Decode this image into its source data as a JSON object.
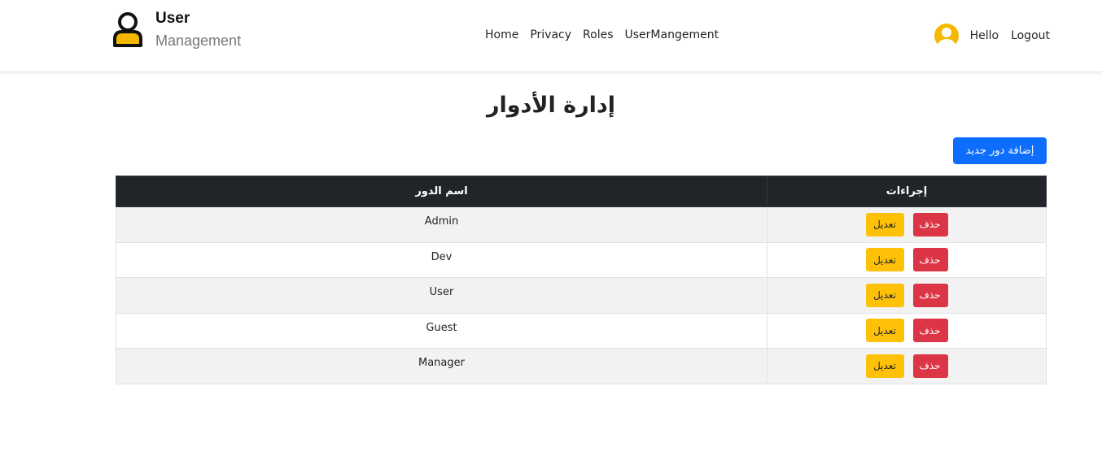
{
  "brand": {
    "title": "User",
    "subtitle": "Management"
  },
  "nav": {
    "links": [
      {
        "label": "Home"
      },
      {
        "label": "Privacy"
      },
      {
        "label": "Roles"
      },
      {
        "label": "UserMangement"
      }
    ],
    "greeting": "Hello",
    "logout_label": "Logout"
  },
  "page": {
    "title": "إدارة الأدوار",
    "add_button_label": "إضافة دور جديد"
  },
  "table": {
    "headers": {
      "name": "اسم الدور",
      "actions": "إجراءات"
    },
    "rows": [
      {
        "name": "Admin"
      },
      {
        "name": "Dev"
      },
      {
        "name": "User"
      },
      {
        "name": "Guest"
      },
      {
        "name": "Manager"
      }
    ],
    "edit_label": "تعديل",
    "delete_label": "حذف"
  },
  "colors": {
    "primary": "#0d6efd",
    "warning": "#ffc107",
    "danger": "#dc3545",
    "header_dark": "#212529",
    "avatar": "#f5b800"
  }
}
